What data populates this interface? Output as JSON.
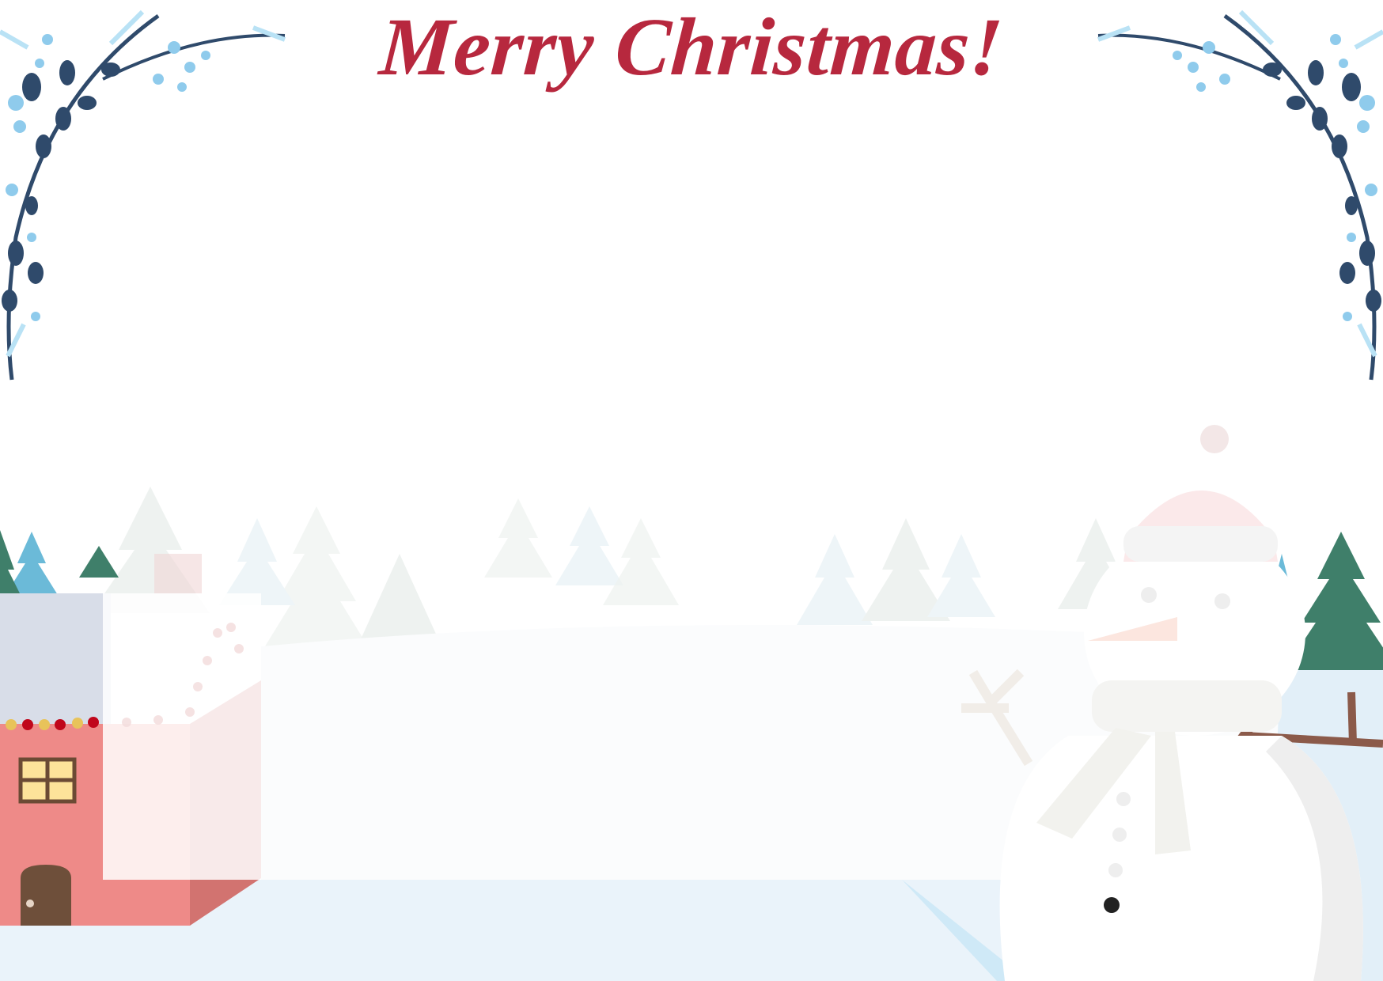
{
  "card": {
    "title": "Merry Christmas!",
    "colors": {
      "title": "#b7283e",
      "leaf_dark": "#2f4a6b",
      "leaf_light": "#8fcbec",
      "snow_ground": "#eaf3fa",
      "house_wall": "#ee8a88",
      "house_roof": "#d8dde8",
      "tree_green": "#3f7f6a",
      "tree_blue": "#6bbad8"
    },
    "icons": [
      "branch-decoration",
      "house",
      "pine-tree",
      "snowman"
    ]
  }
}
